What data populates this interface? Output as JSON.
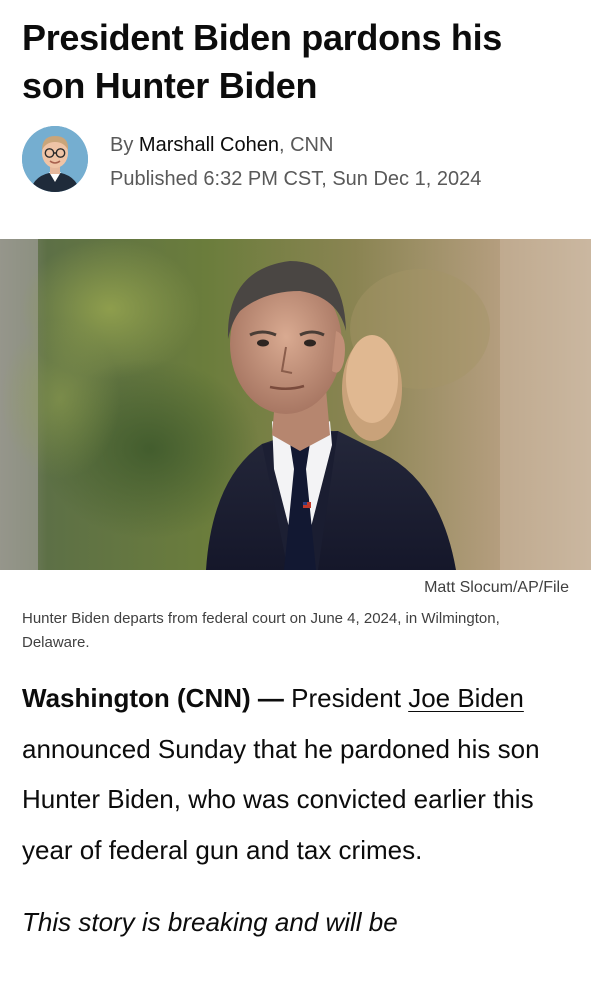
{
  "article": {
    "headline": "President Biden pardons his son Hunter Biden",
    "byline": {
      "prefix": "By ",
      "author": "Marshall Cohen",
      "separator": ", ",
      "source": "CNN"
    },
    "published": "Published 6:32 PM CST, Sun Dec 1, 2024",
    "hero_image": {
      "credit": "Matt Slocum/AP/File",
      "caption": "Hunter Biden departs from federal court on June 4, 2024, in Wilmington, Delaware."
    },
    "body": {
      "dateline": "Washington (CNN) — ",
      "text_before_link": "President ",
      "link_text": "Joe Biden",
      "text_after_link": " announced Sunday that he pardoned his son Hunter Biden, who was convicted earlier this year of federal gun and tax crimes.",
      "note": "This story is breaking and will be"
    }
  }
}
